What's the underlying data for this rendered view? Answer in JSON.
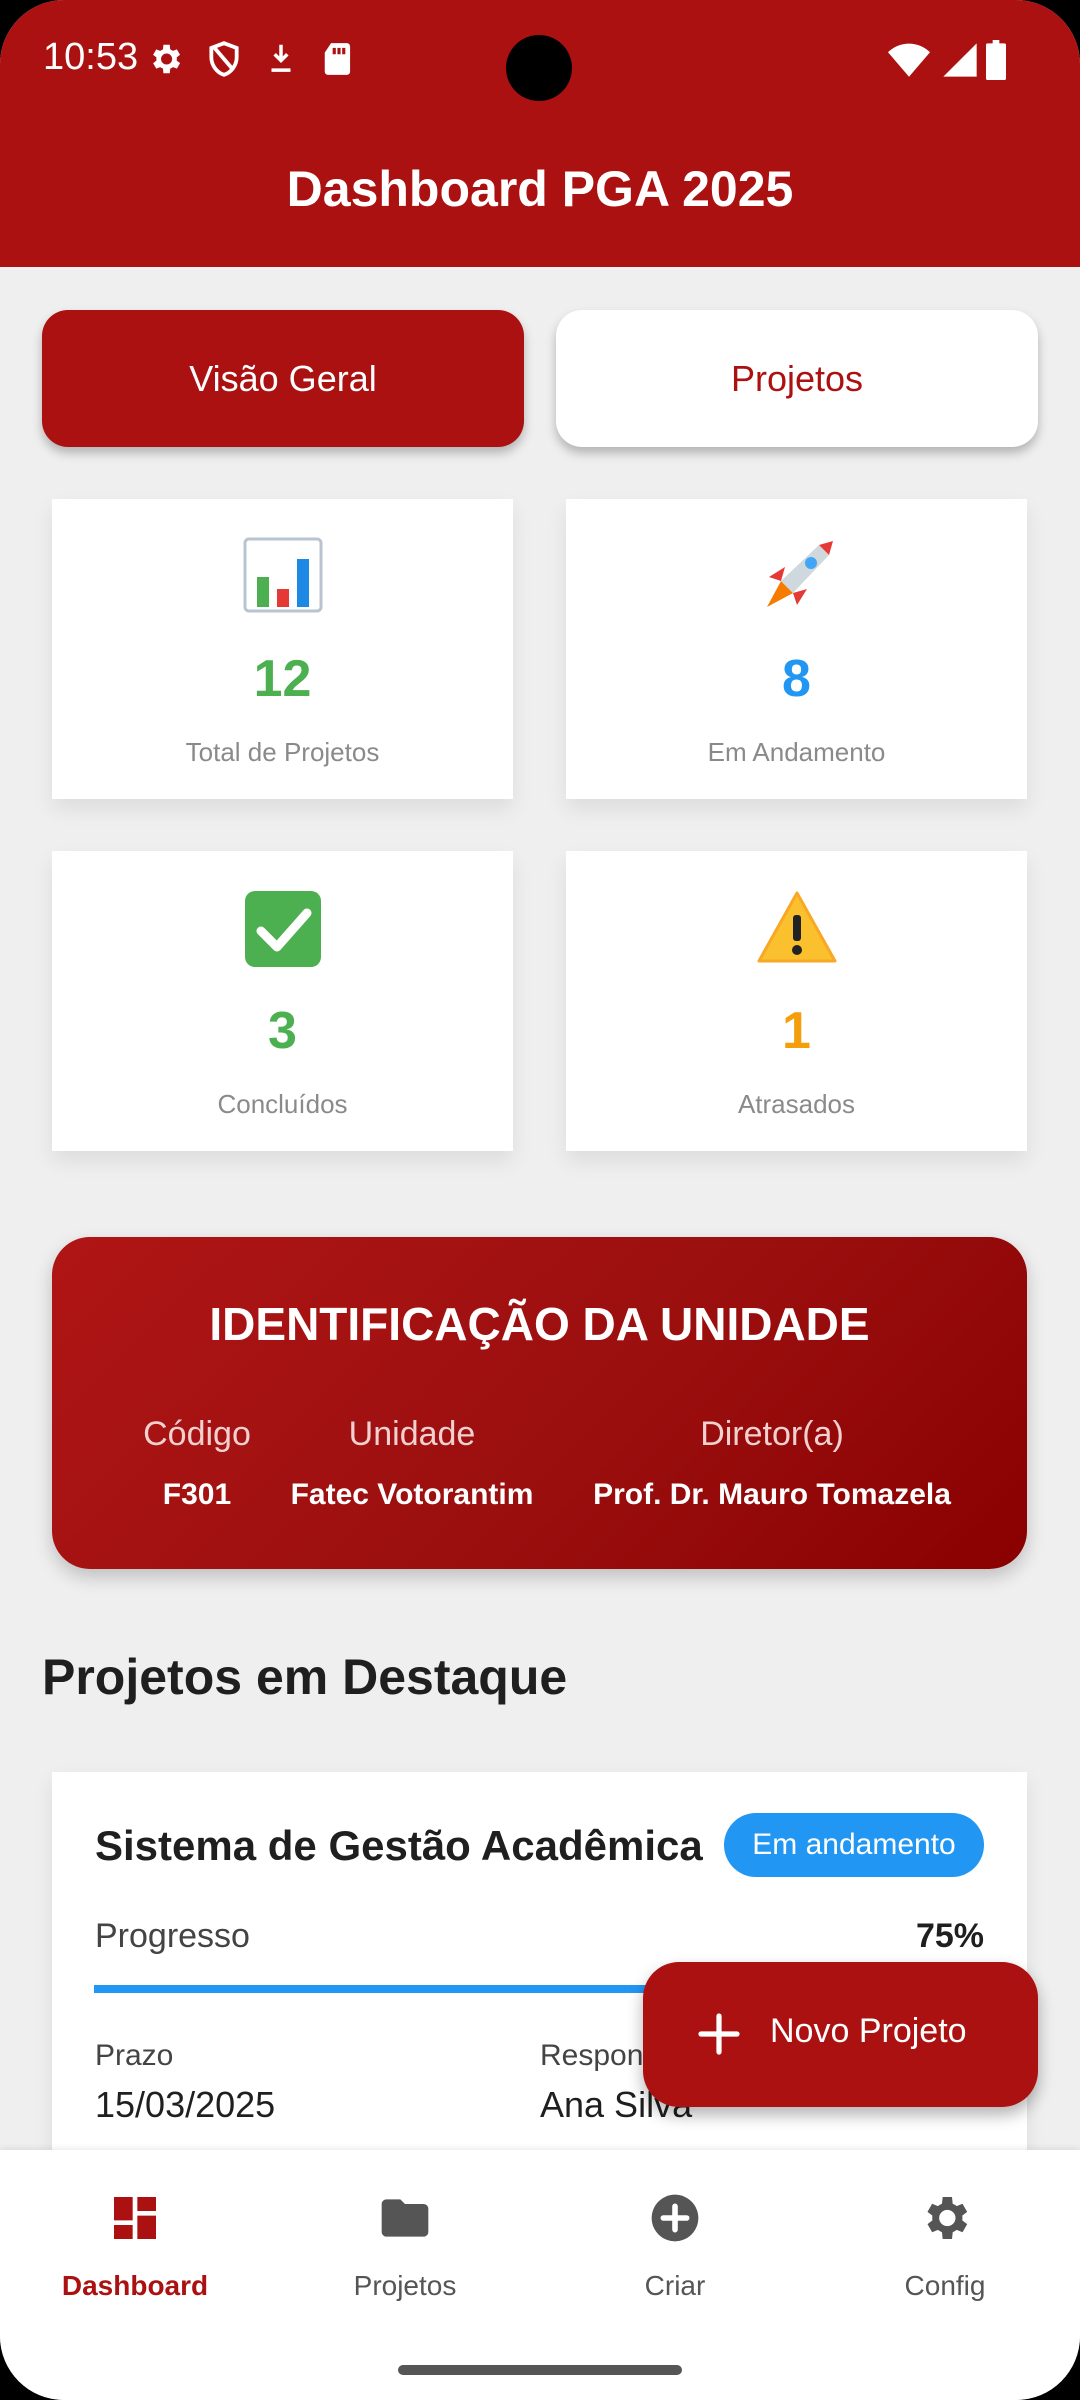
{
  "status_bar": {
    "time": "10:53",
    "left_icons": [
      "gear-icon",
      "shield-icon",
      "download-icon",
      "sd-card-icon"
    ],
    "right_icons": [
      "wifi-icon",
      "cell-signal-icon",
      "battery-icon"
    ]
  },
  "header": {
    "title": "Dashboard PGA 2025"
  },
  "tabs": [
    {
      "label": "Visão Geral",
      "active": true
    },
    {
      "label": "Projetos",
      "active": false
    }
  ],
  "stats": [
    {
      "icon": "bar-chart-emoji",
      "value": "12",
      "label": "Total de Projetos",
      "color": "#4caf50"
    },
    {
      "icon": "rocket-emoji",
      "value": "8",
      "label": "Em Andamento",
      "color": "#2196f3"
    },
    {
      "icon": "check-mark-emoji",
      "value": "3",
      "label": "Concluídos",
      "color": "#4caf50"
    },
    {
      "icon": "warning-emoji",
      "value": "1",
      "label": "Atrasados",
      "color": "#f59e0b"
    }
  ],
  "identification": {
    "title": "IDENTIFICAÇÃO DA UNIDADE",
    "fields": [
      {
        "label": "Código",
        "value": "F301"
      },
      {
        "label": "Unidade",
        "value": "Fatec Votorantim"
      },
      {
        "label": "Diretor(a)",
        "value": "Prof. Dr. Mauro Tomazela"
      }
    ]
  },
  "featured": {
    "title": "Projetos em Destaque",
    "projects": [
      {
        "name": "Sistema de Gestão Acadêmica",
        "status": "Em andamento",
        "progress_label": "Progresso",
        "progress_value": "75%",
        "progress": 0.75,
        "deadline_label": "Prazo",
        "deadline": "15/03/2025",
        "owner_label": "Respon",
        "owner": "Ana Silva"
      }
    ]
  },
  "fab": {
    "label": "Novo Projeto"
  },
  "bottom_nav": [
    {
      "label": "Dashboard",
      "icon": "dashboard-icon",
      "active": true
    },
    {
      "label": "Projetos",
      "icon": "folder-icon",
      "active": false
    },
    {
      "label": "Criar",
      "icon": "add-circle-icon",
      "active": false
    },
    {
      "label": "Config",
      "icon": "settings-icon",
      "active": false
    }
  ],
  "colors": {
    "primary": "#ac1111",
    "accent_blue": "#2196f3",
    "background": "#efefef"
  }
}
